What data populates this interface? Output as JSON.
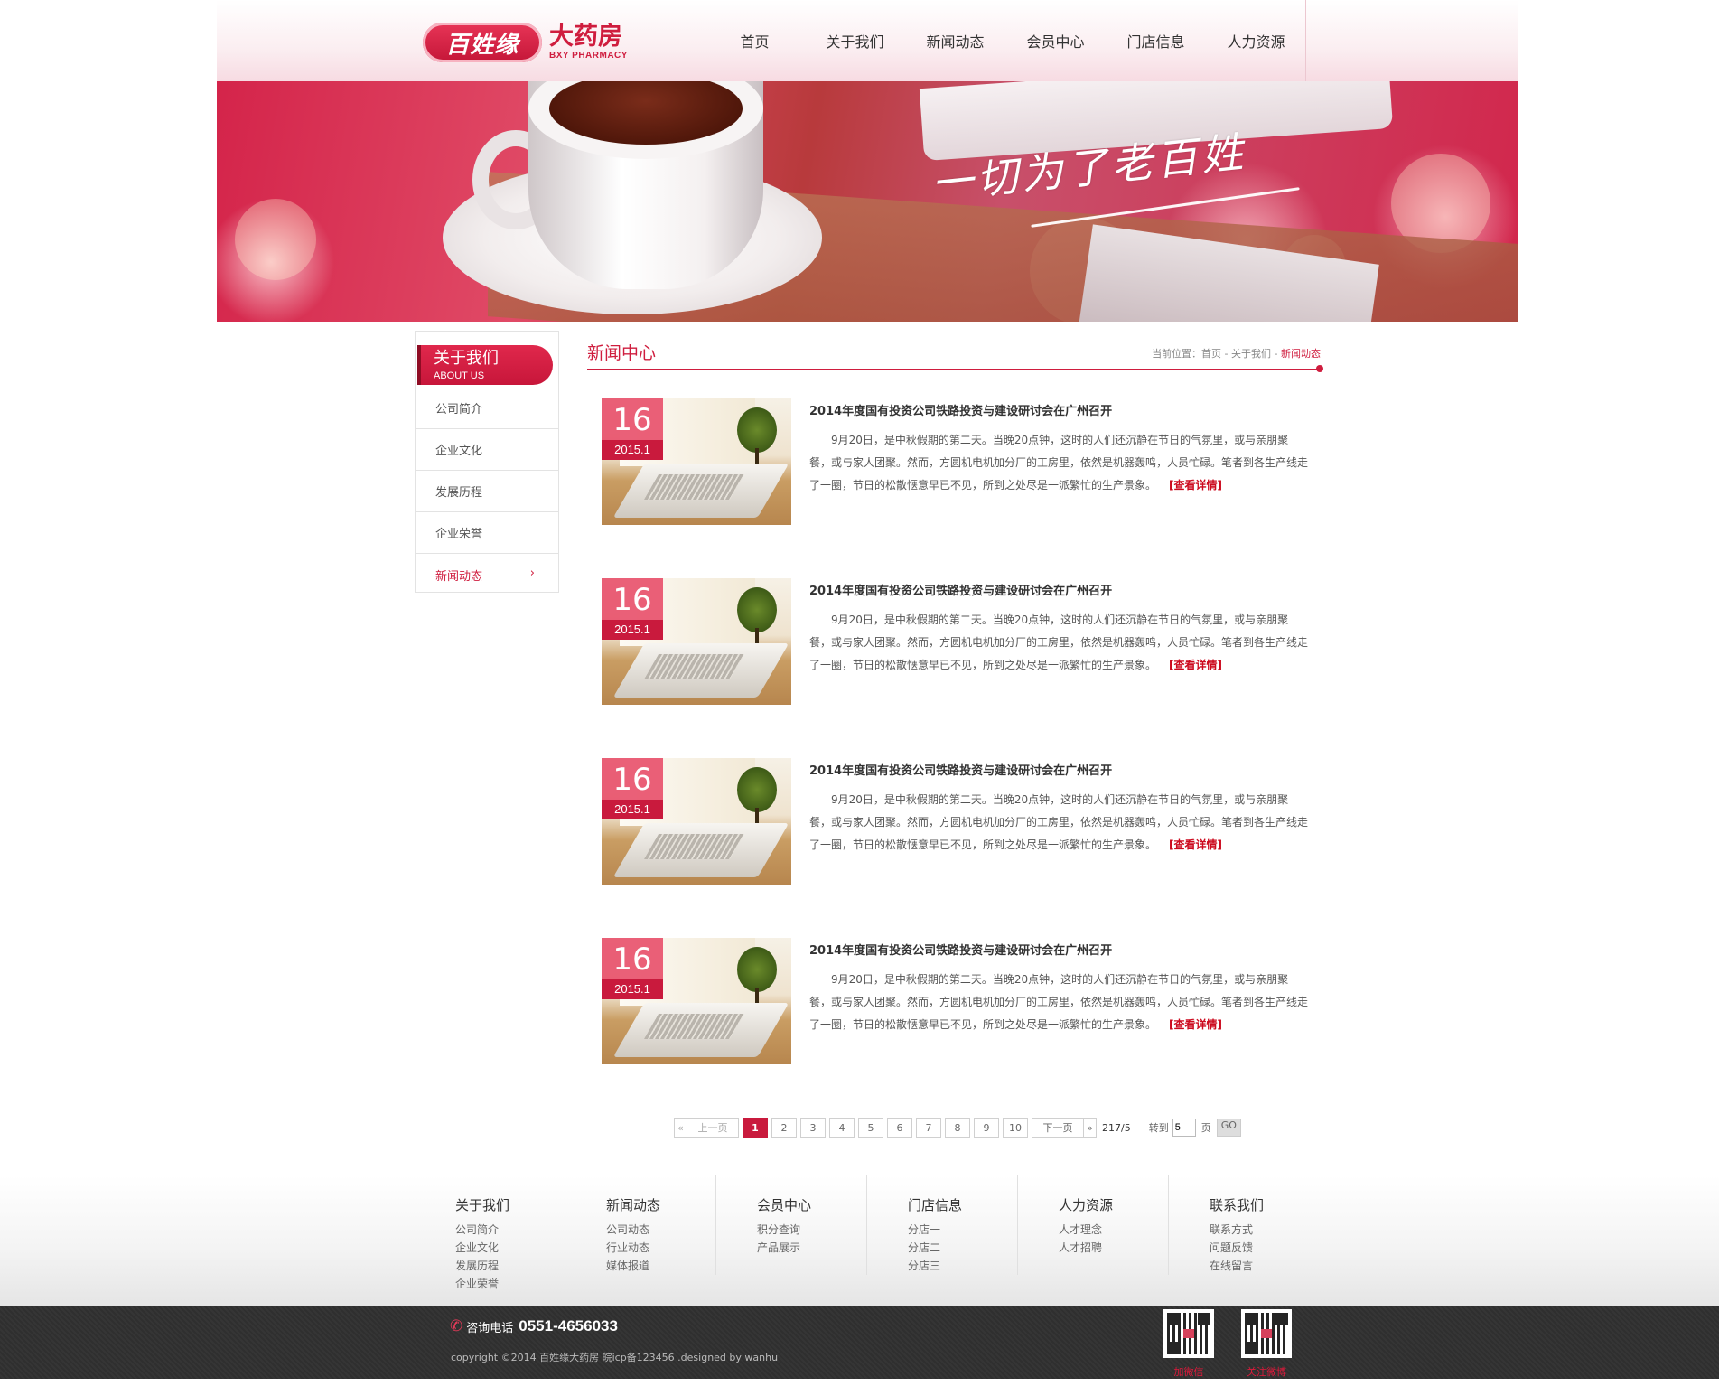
{
  "header": {
    "logo_cn_badge": "百姓缘",
    "logo_cn": "大药房",
    "logo_en": "BXY PHARMACY",
    "nav": [
      "首页",
      "关于我们",
      "新闻动态",
      "会员中心",
      "门店信息",
      "人力资源"
    ]
  },
  "banner": {
    "slogan": "一切为了老百姓"
  },
  "sidebar": {
    "title": "关于我们",
    "subtitle": "ABOUT US",
    "items": [
      "公司简介",
      "企业文化",
      "发展历程",
      "企业荣誉",
      "新闻动态"
    ],
    "active_index": 4,
    "arrow": "›"
  },
  "main": {
    "title": "新闻中心",
    "breadcrumb": {
      "prefix": "当前位置：首页 - 关于我们 - ",
      "current": "新闻动态"
    },
    "news": [
      {
        "day": "16",
        "ym": "2015.1",
        "title": "2014年度国有投资公司铁路投资与建设研讨会在广州召开",
        "summary": "9月20日，是中秋假期的第二天。当晚20点钟，这时的人们还沉静在节日的气氛里，或与亲朋聚餐，或与家人团聚。然而，方圆机电机加分厂的工房里，依然是机器轰鸣，人员忙碌。笔者到各生产线走了一圈，节日的松散惬意早已不见，所到之处尽是一派繁忙的生产景象。",
        "more": "[查看详情]"
      },
      {
        "day": "16",
        "ym": "2015.1",
        "title": "2014年度国有投资公司铁路投资与建设研讨会在广州召开",
        "summary": "9月20日，是中秋假期的第二天。当晚20点钟，这时的人们还沉静在节日的气氛里，或与亲朋聚餐，或与家人团聚。然而，方圆机电机加分厂的工房里，依然是机器轰鸣，人员忙碌。笔者到各生产线走了一圈，节日的松散惬意早已不见，所到之处尽是一派繁忙的生产景象。",
        "more": "[查看详情]"
      },
      {
        "day": "16",
        "ym": "2015.1",
        "title": "2014年度国有投资公司铁路投资与建设研讨会在广州召开",
        "summary": "9月20日，是中秋假期的第二天。当晚20点钟，这时的人们还沉静在节日的气氛里，或与亲朋聚餐，或与家人团聚。然而，方圆机电机加分厂的工房里，依然是机器轰鸣，人员忙碌。笔者到各生产线走了一圈，节日的松散惬意早已不见，所到之处尽是一派繁忙的生产景象。",
        "more": "[查看详情]"
      },
      {
        "day": "16",
        "ym": "2015.1",
        "title": "2014年度国有投资公司铁路投资与建设研讨会在广州召开",
        "summary": "9月20日，是中秋假期的第二天。当晚20点钟，这时的人们还沉静在节日的气氛里，或与亲朋聚餐，或与家人团聚。然而，方圆机电机加分厂的工房里，依然是机器轰鸣，人员忙碌。笔者到各生产线走了一圈，节日的松散惬意早已不见，所到之处尽是一派繁忙的生产景象。",
        "more": "[查看详情]"
      }
    ]
  },
  "pager": {
    "first_arrow": "«",
    "prev": "上一页",
    "pages": [
      "1",
      "2",
      "3",
      "4",
      "5",
      "6",
      "7",
      "8",
      "9",
      "10"
    ],
    "current": "1",
    "next": "下一页",
    "last_arrow": "»",
    "total": "217/5",
    "goto_label": "转到",
    "goto_value": "5",
    "page_unit": "页",
    "go": "GO"
  },
  "footer": {
    "columns": [
      {
        "title": "关于我们",
        "links": [
          "公司简介",
          "企业文化",
          "发展历程",
          "企业荣誉"
        ]
      },
      {
        "title": "新闻动态",
        "links": [
          "公司动态",
          "行业动态",
          "媒体报道"
        ]
      },
      {
        "title": "会员中心",
        "links": [
          "积分查询",
          "产品展示"
        ]
      },
      {
        "title": "门店信息",
        "links": [
          "分店一",
          "分店二",
          "分店三"
        ]
      },
      {
        "title": "人力资源",
        "links": [
          "人才理念",
          "人才招聘"
        ]
      },
      {
        "title": "联系我们",
        "links": [
          "联系方式",
          "问题反馈",
          "在线留言"
        ]
      }
    ],
    "phone_label": "咨询电话",
    "phone": "0551-4656033",
    "copyright": "copyright ©2014 百姓缘大药房 皖icp备123456 .designed by wanhu",
    "qr": [
      {
        "label": "加微信"
      },
      {
        "label": "关注微博"
      }
    ],
    "accent_color": "#cf1d3e"
  }
}
